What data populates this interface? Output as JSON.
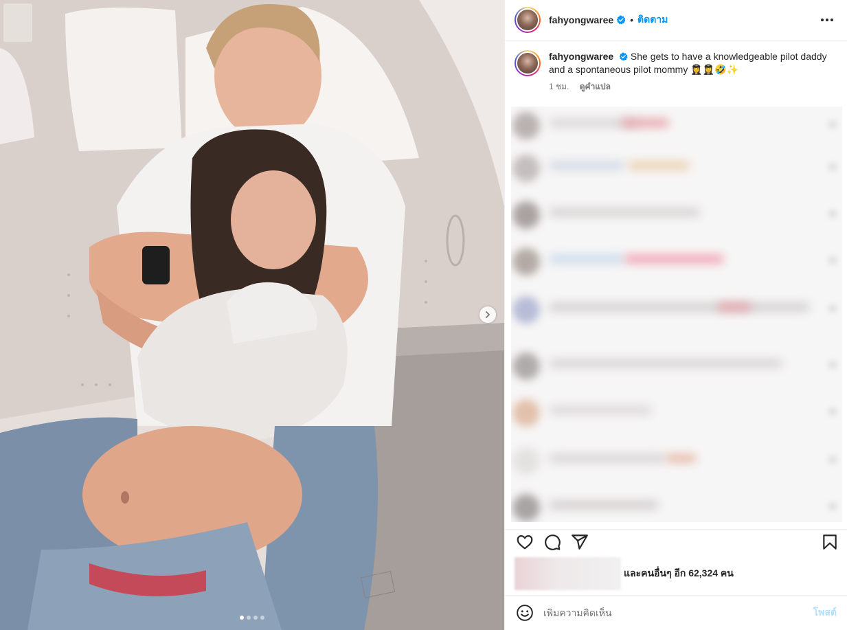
{
  "post": {
    "username": "fahyongwaree",
    "follow_label": "ติดตาม",
    "separator": "•"
  },
  "caption": {
    "username": "fahyongwaree",
    "text": "She gets to have a knowledgeable pilot daddy and a spontaneous pilot mommy 👩‍✈️👩‍✈️🤣✨",
    "time": "1 ชม.",
    "translate_label": "ดูคำแปล"
  },
  "likes": {
    "text": "และคนอื่นๆ อีก 62,324 คน"
  },
  "comment_box": {
    "placeholder": "เพิ่มความคิดเห็น",
    "post_label": "โพสต์"
  },
  "carousel": {
    "slide_count": 4,
    "active_index": 0
  },
  "icons": {
    "verified": "verified-badge-icon",
    "more": "more-options-icon",
    "like": "heart-icon",
    "comment": "comment-bubble-icon",
    "share": "paper-plane-icon",
    "save": "bookmark-icon",
    "emoji": "smiley-icon",
    "next": "chevron-right-icon"
  },
  "colors": {
    "accent": "#0095f6",
    "text": "#262626",
    "muted": "#737373",
    "post_disabled": "#b2dffc",
    "divider": "#efefef"
  }
}
